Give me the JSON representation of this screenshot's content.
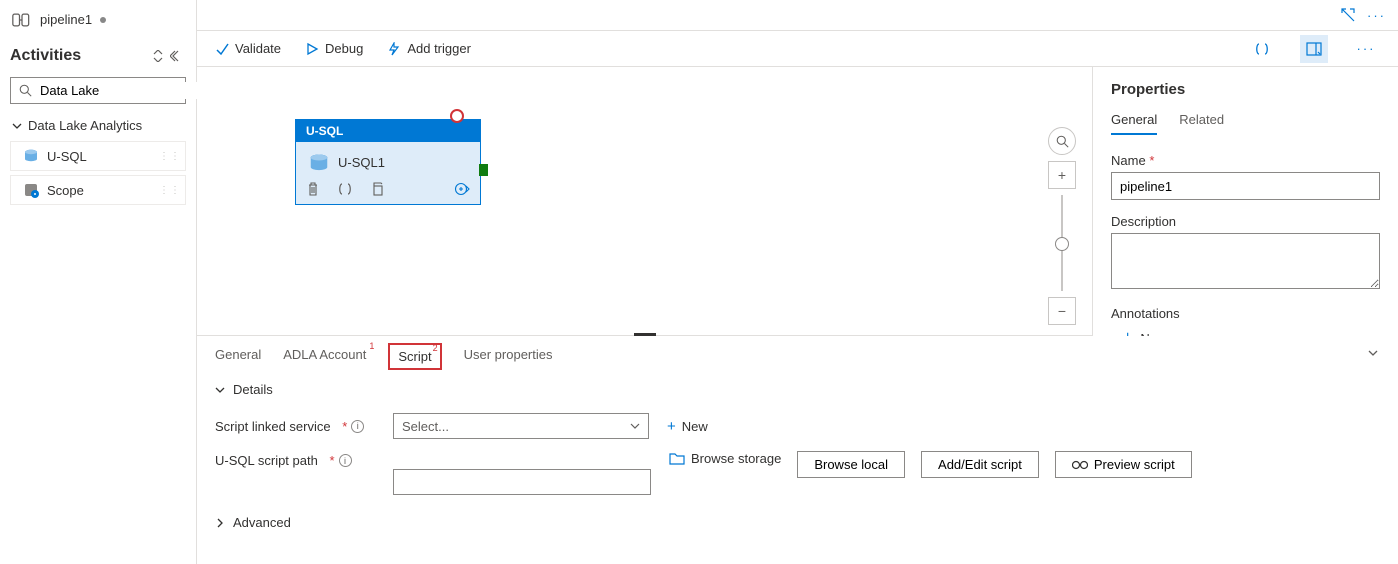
{
  "header": {
    "pipeline_name": "pipeline1"
  },
  "activities": {
    "title": "Activities",
    "search_value": "Data Lake",
    "category": "Data Lake Analytics",
    "items": [
      {
        "label": "U-SQL"
      },
      {
        "label": "Scope"
      }
    ]
  },
  "toolbar": {
    "validate": "Validate",
    "debug": "Debug",
    "add_trigger": "Add trigger"
  },
  "canvas": {
    "node": {
      "type": "U-SQL",
      "name": "U-SQL1"
    }
  },
  "bottom": {
    "tabs": {
      "general": "General",
      "adla": "ADLA Account",
      "script": "Script",
      "user_props": "User properties"
    },
    "details": "Details",
    "linked_service_label": "Script linked service",
    "linked_service_placeholder": "Select...",
    "new": "New",
    "script_path_label": "U-SQL script path",
    "browse_storage": "Browse storage",
    "browse_local": "Browse local",
    "add_edit": "Add/Edit script",
    "preview": "Preview script",
    "advanced": "Advanced"
  },
  "props": {
    "title": "Properties",
    "tabs": {
      "general": "General",
      "related": "Related"
    },
    "name_label": "Name",
    "name_value": "pipeline1",
    "desc_label": "Description",
    "desc_value": "",
    "ann_label": "Annotations",
    "new": "New"
  }
}
